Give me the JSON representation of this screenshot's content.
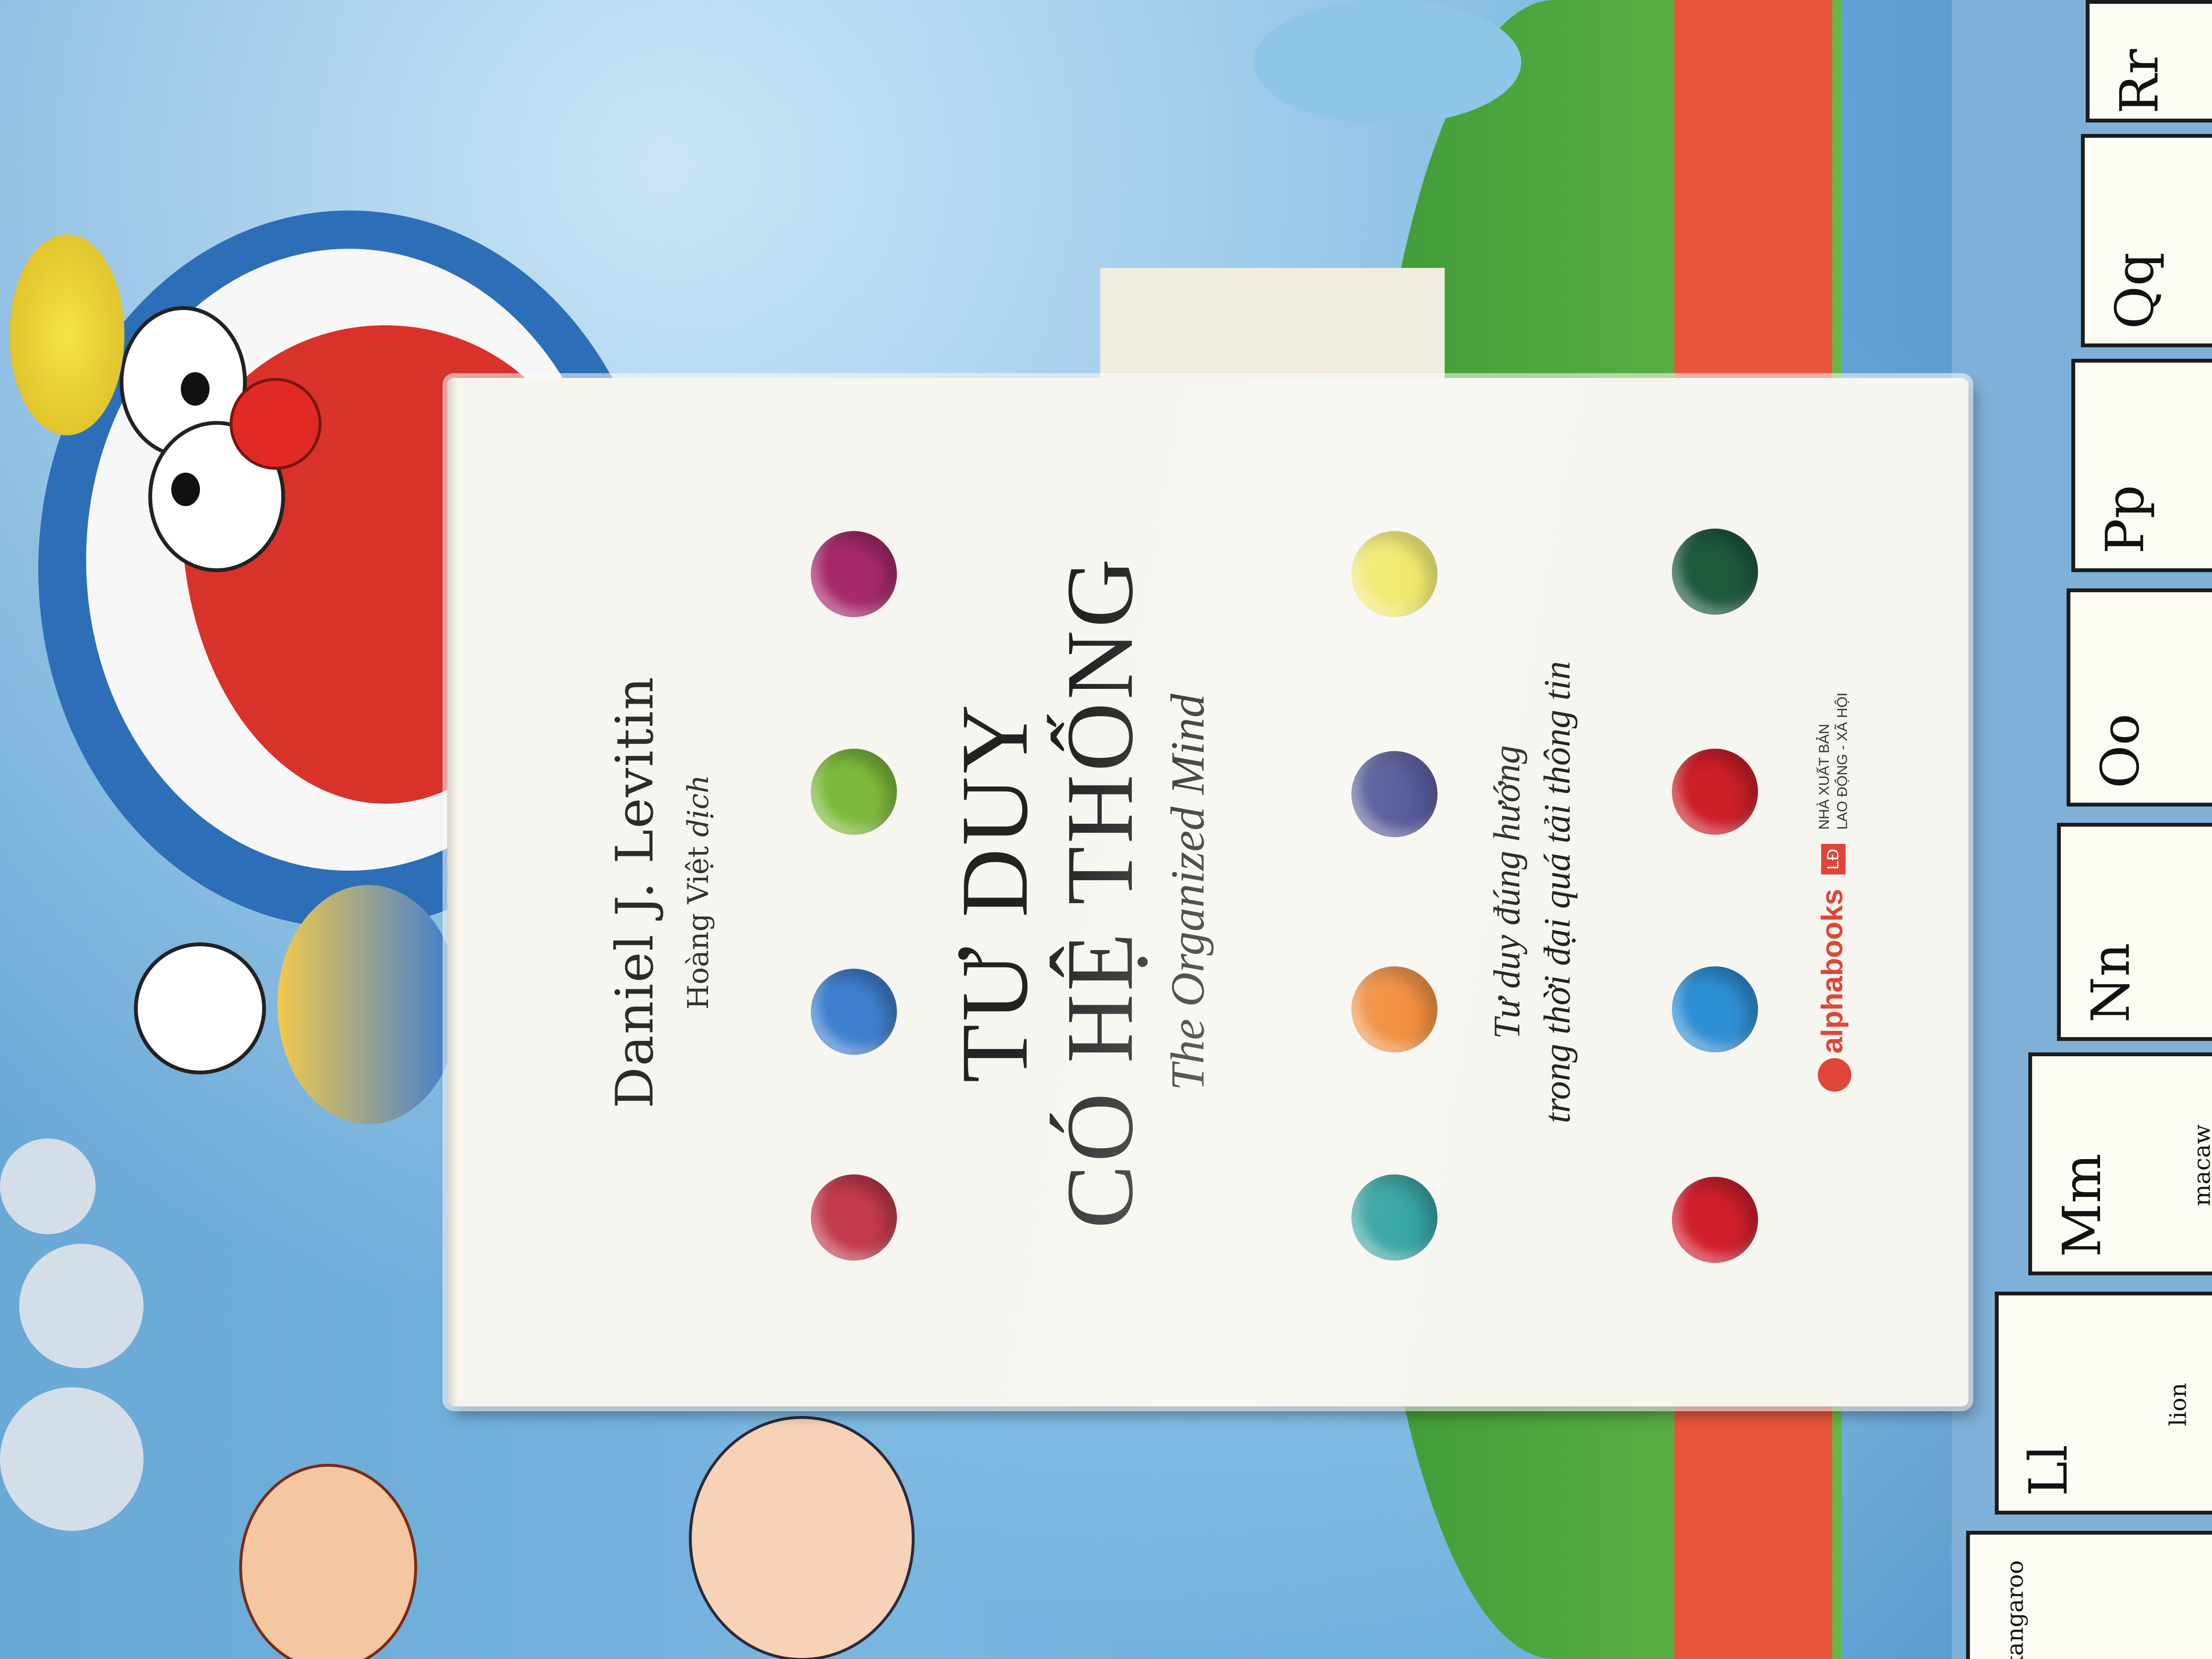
{
  "background": {
    "alphabet_cards": [
      {
        "letter": "Rr",
        "word": ""
      },
      {
        "letter": "Qq",
        "word": ""
      },
      {
        "letter": "Pp",
        "word": ""
      },
      {
        "letter": "Oo",
        "word": ""
      },
      {
        "letter": "Nn",
        "word": ""
      },
      {
        "letter": "Mm",
        "word": "macaw"
      },
      {
        "letter": "Ll",
        "word": "lion"
      },
      {
        "letter": "",
        "word": "kangaroo"
      }
    ]
  },
  "book": {
    "author": "Daniel J. Levitin",
    "translator_name": "Hoàng Việt",
    "translator_role": "dịch",
    "title_line1": "TƯ DUY",
    "title_line2": "CÓ HỆ THỐNG",
    "subtitle_en": "The Organized Mind",
    "tagline_line1": "Tư duy đúng hướng",
    "tagline_line2": "trong thời đại quá tải thông tin",
    "publisher_logo": "alphabooks",
    "publisher_badge": "LĐ",
    "publisher_line1": "NHÀ XUẤT BẢN",
    "publisher_line2": "LAO ĐỘNG - XÃ HỘI",
    "dot_colors": [
      "#c23a4c",
      "#3f7fcf",
      "#7dba3c",
      "#a52a6a",
      "#1f9a98",
      "#ef7a1c",
      "#2a2f7e",
      "#ebe13a",
      "#d11f2d",
      "#2f8fd4",
      "#cc1f28",
      "#1e5a3e"
    ]
  }
}
